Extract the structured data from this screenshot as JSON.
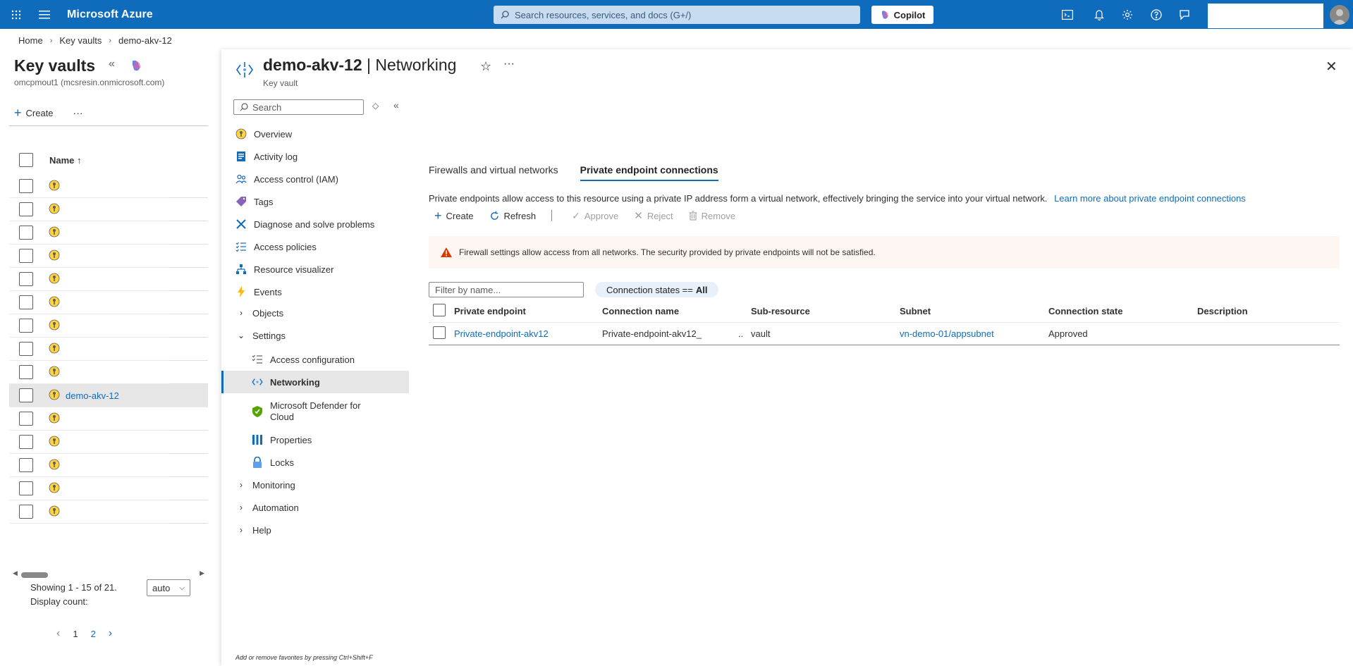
{
  "topbar": {
    "brand": "Microsoft Azure",
    "search_placeholder": "Search resources, services, and docs (G+/)",
    "copilot_label": "Copilot",
    "accent": "#0f6cbd"
  },
  "breadcrumb": [
    "Home",
    "Key vaults",
    "demo-akv-12"
  ],
  "left_panel": {
    "title": "Key vaults",
    "subtitle": "omcpmout1 (mcsresin.onmicrosoft.com)",
    "create_label": "Create",
    "more_label": "···",
    "column_name": "Name ↑",
    "rows": [
      {
        "name": ""
      },
      {
        "name": ""
      },
      {
        "name": ""
      },
      {
        "name": ""
      },
      {
        "name": ""
      },
      {
        "name": ""
      },
      {
        "name": ""
      },
      {
        "name": ""
      },
      {
        "name": ""
      },
      {
        "name": "demo-akv-12"
      },
      {
        "name": ""
      },
      {
        "name": ""
      },
      {
        "name": ""
      },
      {
        "name": ""
      },
      {
        "name": ""
      }
    ],
    "showing": "Showing 1 - 15 of 21.",
    "display_count_label": "Display count:",
    "display_count_value": "auto",
    "pages": [
      "1",
      "2"
    ]
  },
  "blade": {
    "title_resource": "demo-akv-12",
    "title_section": " | Networking",
    "subtitle": "Key vault"
  },
  "menu": {
    "search_placeholder": "Search",
    "items": [
      {
        "label": "Overview"
      },
      {
        "label": "Activity log"
      },
      {
        "label": "Access control (IAM)"
      },
      {
        "label": "Tags"
      },
      {
        "label": "Diagnose and solve problems"
      },
      {
        "label": "Access policies"
      },
      {
        "label": "Resource visualizer"
      },
      {
        "label": "Events"
      },
      {
        "label": "Objects"
      },
      {
        "label": "Settings"
      },
      {
        "label": "Access configuration"
      },
      {
        "label": "Networking"
      },
      {
        "label": "Microsoft Defender for Cloud"
      },
      {
        "label": "Properties"
      },
      {
        "label": "Locks"
      },
      {
        "label": "Monitoring"
      },
      {
        "label": "Automation"
      },
      {
        "label": "Help"
      }
    ],
    "shortcut_hint": "Add or remove favorites by pressing Ctrl+Shift+F"
  },
  "content": {
    "tabs": [
      "Firewalls and virtual networks",
      "Private endpoint connections"
    ],
    "description": "Private endpoints allow access to this resource using a private IP address form a virtual network, effectively bringing the service into your virtual network.",
    "learn_more": "Learn more about private endpoint connections",
    "toolbar": {
      "create": "Create",
      "refresh": "Refresh",
      "approve": "Approve",
      "reject": "Reject",
      "remove": "Remove"
    },
    "warning": "Firewall settings allow access from all networks. The security provided by private endpoints will not be satisfied.",
    "filter_placeholder": "Filter by name...",
    "pill_prefix": "Connection states ==",
    "pill_value": "All",
    "table": {
      "headers": [
        "Private endpoint",
        "Connection name",
        "Sub-resource",
        "Subnet",
        "Connection state",
        "Description"
      ],
      "rows": [
        {
          "private_endpoint": "Private-endpoint-akv12",
          "connection_name": "Private-endpoint-akv12_",
          "connection_ellipsis": "..",
          "sub_resource": "vault",
          "subnet": "vn-demo-01/appsubnet",
          "state": "Approved",
          "description": ""
        }
      ]
    }
  }
}
